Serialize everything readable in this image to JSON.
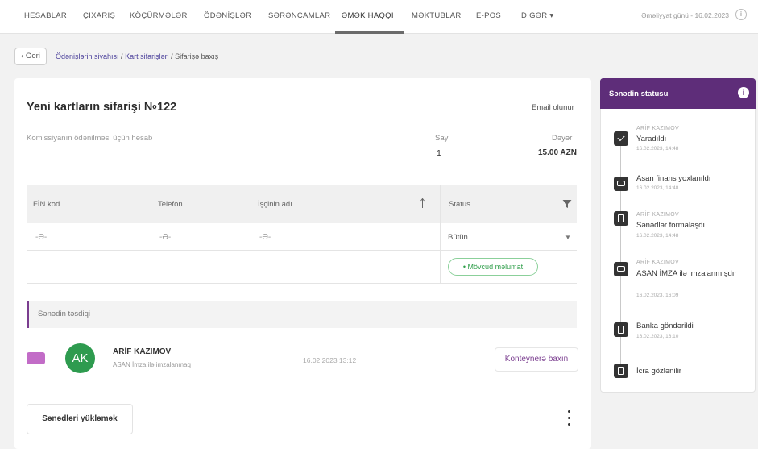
{
  "nav": {
    "items": [
      "HESABLAR",
      "ÇIXARIŞ",
      "KÖÇÜRMƏLƏR",
      "ÖDƏNİŞLƏR",
      "SƏRƏNCAMLAR",
      "ƏMƏK HAQQI",
      "MƏKTUBLAR",
      "E-POS",
      "DİGƏR ▾"
    ],
    "active": "ƏMƏK HAQQI",
    "operation_date": "Əməliyyat günü - 16.02.2023"
  },
  "breadcrumb": {
    "back_label": "‹ Geri",
    "link1": "Ödənişlərin siyahısı",
    "link2": "Kart sifarişləri",
    "current": "Sifarişə baxış",
    "sep": " / "
  },
  "order": {
    "title": "Yeni kartların sifarişi №122",
    "email_label": "Email olunur",
    "commission_label": "Komissiyanın ödənilməsi üçün hesab",
    "count_label": "Say",
    "count_value": "1",
    "amount_label": "Dəyər",
    "amount_value": "15.00 AZN"
  },
  "table": {
    "columns": [
      "FİN kod",
      "Telefon",
      "İşçinin adı",
      "Status"
    ],
    "filter_row": [
      "-Ə-",
      "-Ə-",
      "-Ə-"
    ],
    "status_select": "Bütün",
    "status_badge": "• Mövcud məlumat"
  },
  "confirmation": {
    "section_label": "Sənədin təsdiqi",
    "avatar_initials": "AK",
    "signer_name": "ARİF KAZIMOV",
    "signer_sub": "ASAN İmza ilə imzalanmaq",
    "sign_date": "16.02.2023 13:12",
    "container_button": "Konteynerə baxın",
    "download_button": "Sənədləri yükləmək"
  },
  "status_panel": {
    "title": "Sənədin statusu",
    "info_icon": "i",
    "events": [
      {
        "who": "ARİF KAZIMOV",
        "title": "Yaradıldı",
        "time": "16.02.2023, 14:48",
        "icon": "check-icon"
      },
      {
        "who": "",
        "title": "Asan finans yoxlanıldı",
        "time": "16.02.2023, 14:48",
        "icon": "chat-icon"
      },
      {
        "who": "ARİF KAZIMOV",
        "title": "Sənədlər formalaşdı",
        "time": "16.02.2023, 14:48",
        "icon": "document-icon"
      },
      {
        "who": "ARİF KAZIMOV",
        "title": "ASAN İMZA ilə imzalanmışdır",
        "time": "16.02.2023, 16:09",
        "icon": "chat-icon"
      },
      {
        "who": "",
        "title": "Banka göndərildi",
        "time": "16.02.2023, 16:10",
        "icon": "document-icon"
      },
      {
        "who": "",
        "title": "İcra gözlənilir",
        "time": "",
        "icon": "document-icon"
      }
    ]
  },
  "colors": {
    "brand_purple": "#5e2d79",
    "accent_purple": "#7a3d8f",
    "avatar_green": "#2e9b4f",
    "badge_green": "#2f9e4a"
  }
}
